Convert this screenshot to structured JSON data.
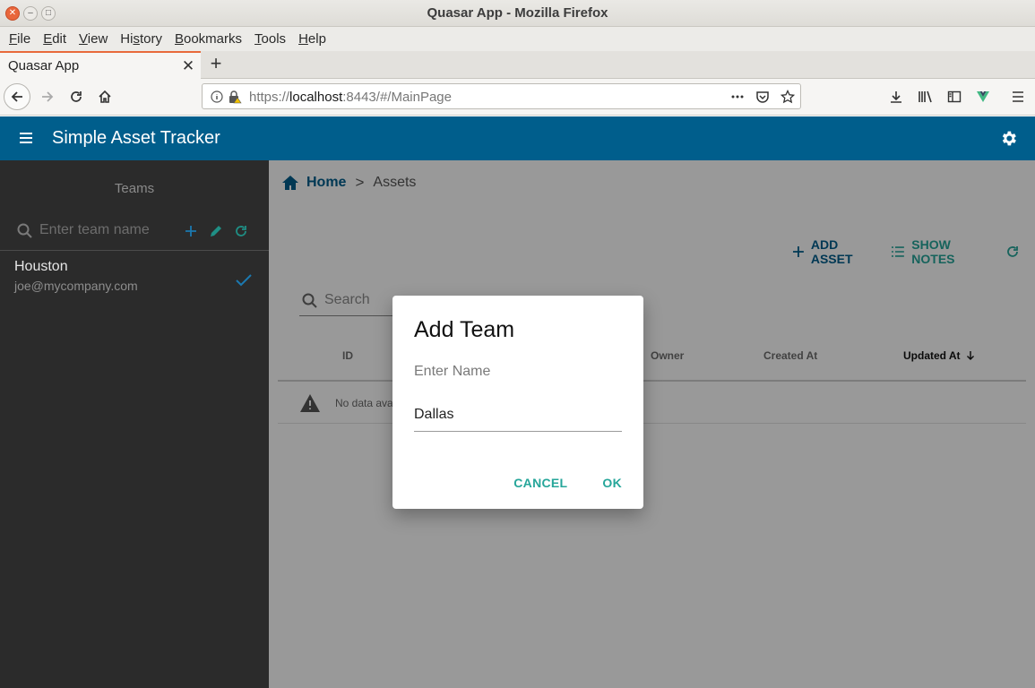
{
  "window": {
    "title": "Quasar App - Mozilla Firefox"
  },
  "menubar": {
    "items": [
      "File",
      "Edit",
      "View",
      "History",
      "Bookmarks",
      "Tools",
      "Help"
    ],
    "underline": [
      "F",
      "E",
      "V",
      "s",
      "B",
      "T",
      "H"
    ]
  },
  "tab": {
    "title": "Quasar App"
  },
  "url": {
    "prefix": "https://",
    "host": "localhost",
    "rest": ":8443/#/MainPage"
  },
  "app": {
    "title": "Simple Asset Tracker"
  },
  "drawer": {
    "teams_label": "Teams",
    "search_placeholder": "Enter team name",
    "team": {
      "name": "Houston",
      "email": "joe@mycompany.com"
    }
  },
  "breadcrumb": {
    "home": "Home",
    "separator": ">",
    "current": "Assets"
  },
  "toolbar": {
    "add_asset": "ADD ASSET",
    "show_notes": "SHOW NOTES"
  },
  "assets": {
    "search_placeholder": "Search",
    "columns": [
      "ID",
      "Owner",
      "Created At",
      "Updated At"
    ],
    "no_data": "No data ava"
  },
  "dialog": {
    "title": "Add Team",
    "label": "Enter Name",
    "value": "Dallas",
    "cancel": "CANCEL",
    "ok": "OK"
  },
  "colors": {
    "primary": "#005e8c",
    "secondary": "#26a69a",
    "drawer": "#2b2b2b"
  }
}
